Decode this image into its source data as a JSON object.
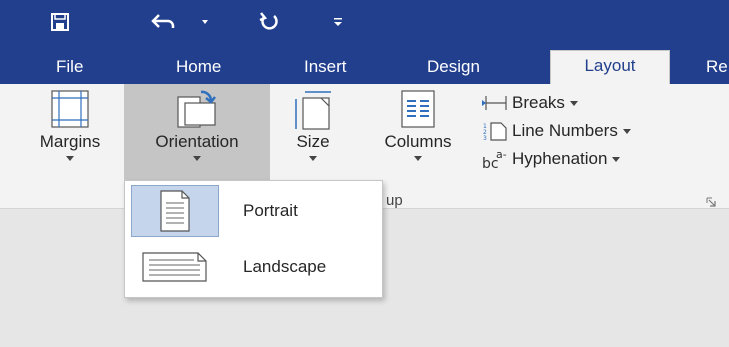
{
  "qat": {
    "icons": [
      "save-icon",
      "undo-icon",
      "dropdown-arrow-icon",
      "redo-icon",
      "customize-qat-icon"
    ]
  },
  "tabs": [
    {
      "label": "File"
    },
    {
      "label": "Home"
    },
    {
      "label": "Insert"
    },
    {
      "label": "Design"
    },
    {
      "label": "Layout",
      "active": true
    },
    {
      "label": "Re"
    }
  ],
  "ribbon": {
    "buttons": {
      "margins": {
        "label": "Margins",
        "icon": "margins-icon"
      },
      "orientation": {
        "label": "Orientation",
        "icon": "orientation-icon",
        "pressed": true
      },
      "size": {
        "label": "Size",
        "icon": "size-icon"
      },
      "columns": {
        "label": "Columns",
        "icon": "columns-icon"
      }
    },
    "small_buttons": {
      "breaks": {
        "label": "Breaks",
        "icon": "breaks-icon"
      },
      "line_numbers": {
        "label": "Line Numbers",
        "icon": "line-numbers-icon"
      },
      "hyphenation": {
        "label": "Hyphenation",
        "icon": "hyphenation-icon"
      }
    },
    "group_label_visible": "up",
    "launcher_icon": "dialog-launcher-icon"
  },
  "orientation_menu": {
    "items": [
      {
        "label": "Portrait",
        "icon": "portrait-icon",
        "selected": true
      },
      {
        "label": "Landscape",
        "icon": "landscape-icon",
        "selected": false
      }
    ]
  },
  "colors": {
    "title_bar": "#223f8e",
    "ribbon_bg": "#f3f3f3",
    "pressed": "#c5c5c5",
    "selected_item": "#c5d6ec",
    "doc_area": "#e6e6e6"
  }
}
